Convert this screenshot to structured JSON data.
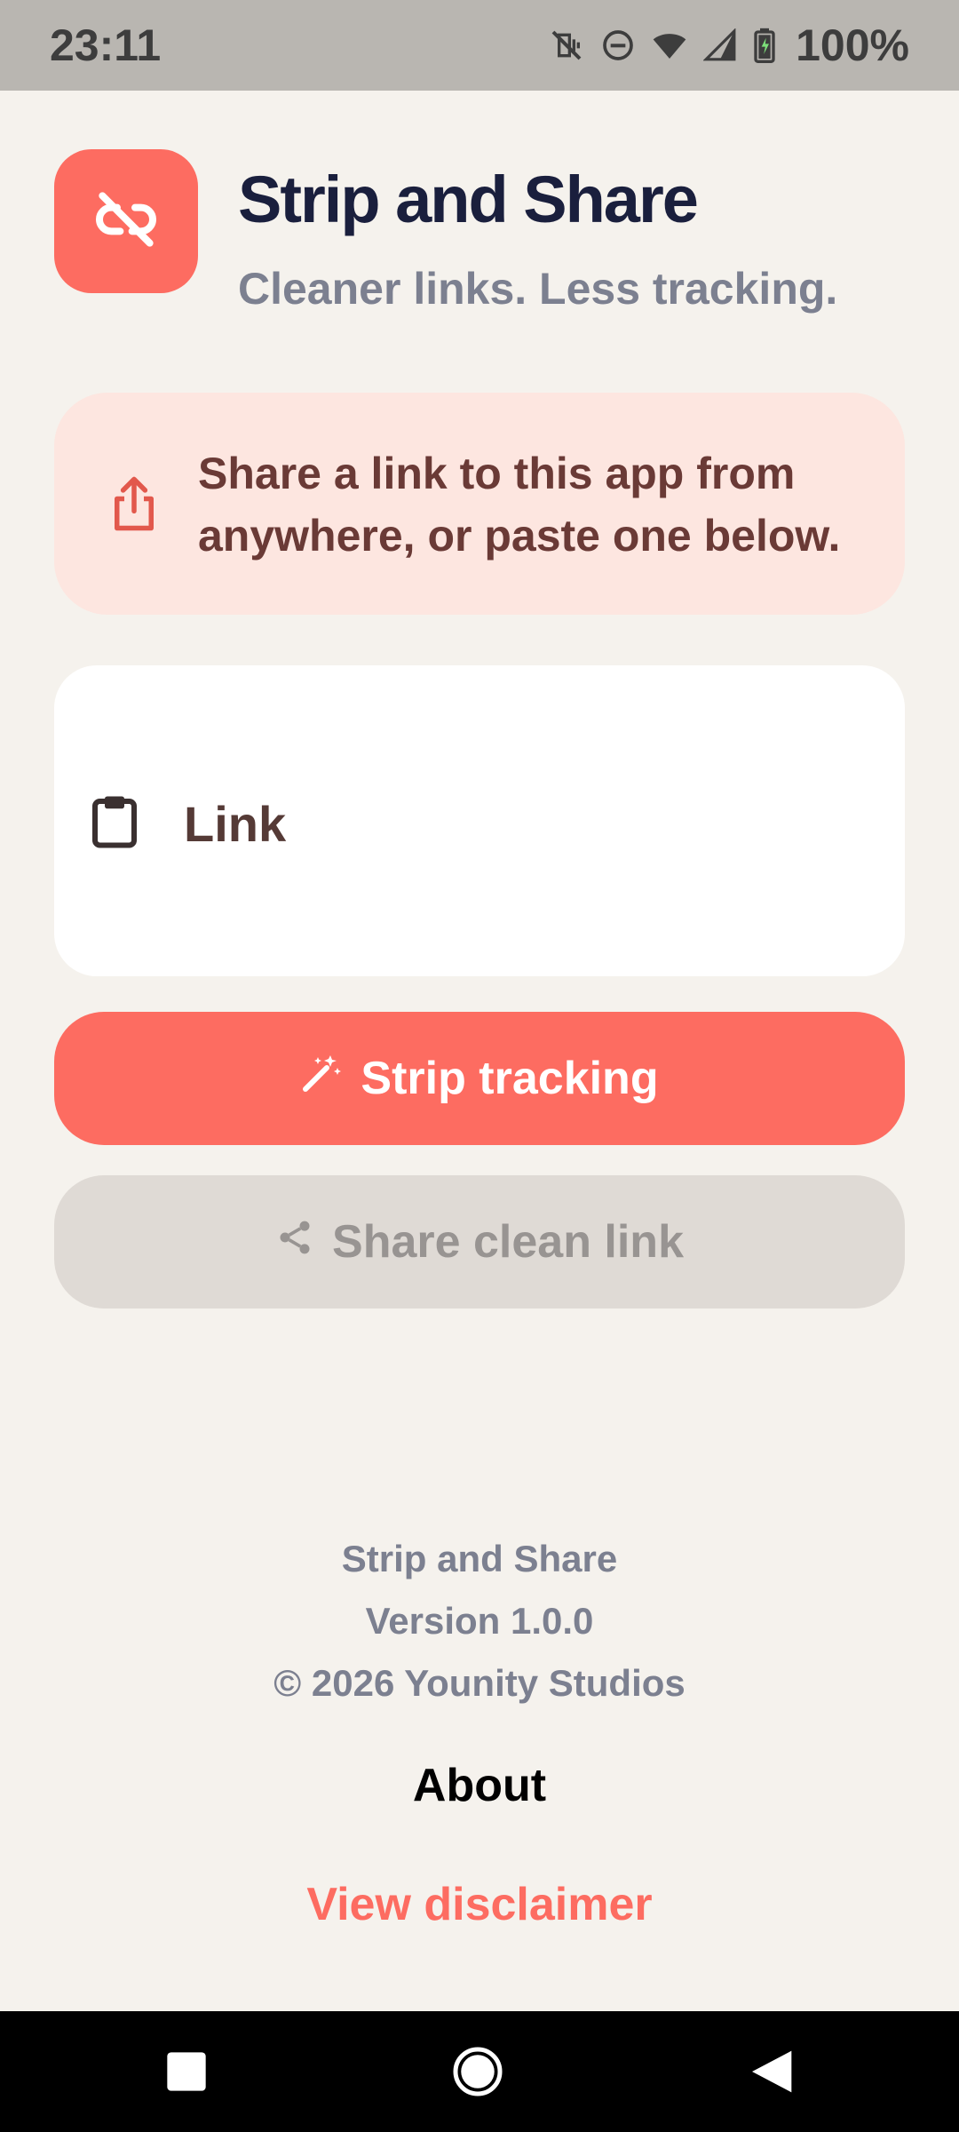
{
  "status_bar": {
    "time": "23:11",
    "battery": "100%",
    "icons": [
      "vibrate-off-icon",
      "dnd-icon",
      "wifi-icon",
      "signal-icon",
      "battery-charging-icon"
    ]
  },
  "header": {
    "icon": "link-off-icon",
    "title": "Strip and Share",
    "subtitle": "Cleaner links. Less tracking."
  },
  "info_card": {
    "icon": "share-icon",
    "text": "Share a link to this app from anywhere, or paste one below."
  },
  "link_input": {
    "icon": "clipboard-icon",
    "label": "Link",
    "value": ""
  },
  "actions": {
    "strip_label": "Strip tracking",
    "strip_icon": "magic-wand-icon",
    "share_label": "Share clean link",
    "share_icon": "share-nodes-icon"
  },
  "footer": {
    "app_name": "Strip and Share",
    "version": "Version 1.0.0",
    "copyright": "© 2026 Younity Studios"
  },
  "about": {
    "title": "About",
    "disclaimer_link": "View disclaimer"
  },
  "colors": {
    "accent": "#fd6c61",
    "background": "#f5f2ed",
    "info_bg": "#fde6e0",
    "disabled_bg": "#dfdad5"
  }
}
